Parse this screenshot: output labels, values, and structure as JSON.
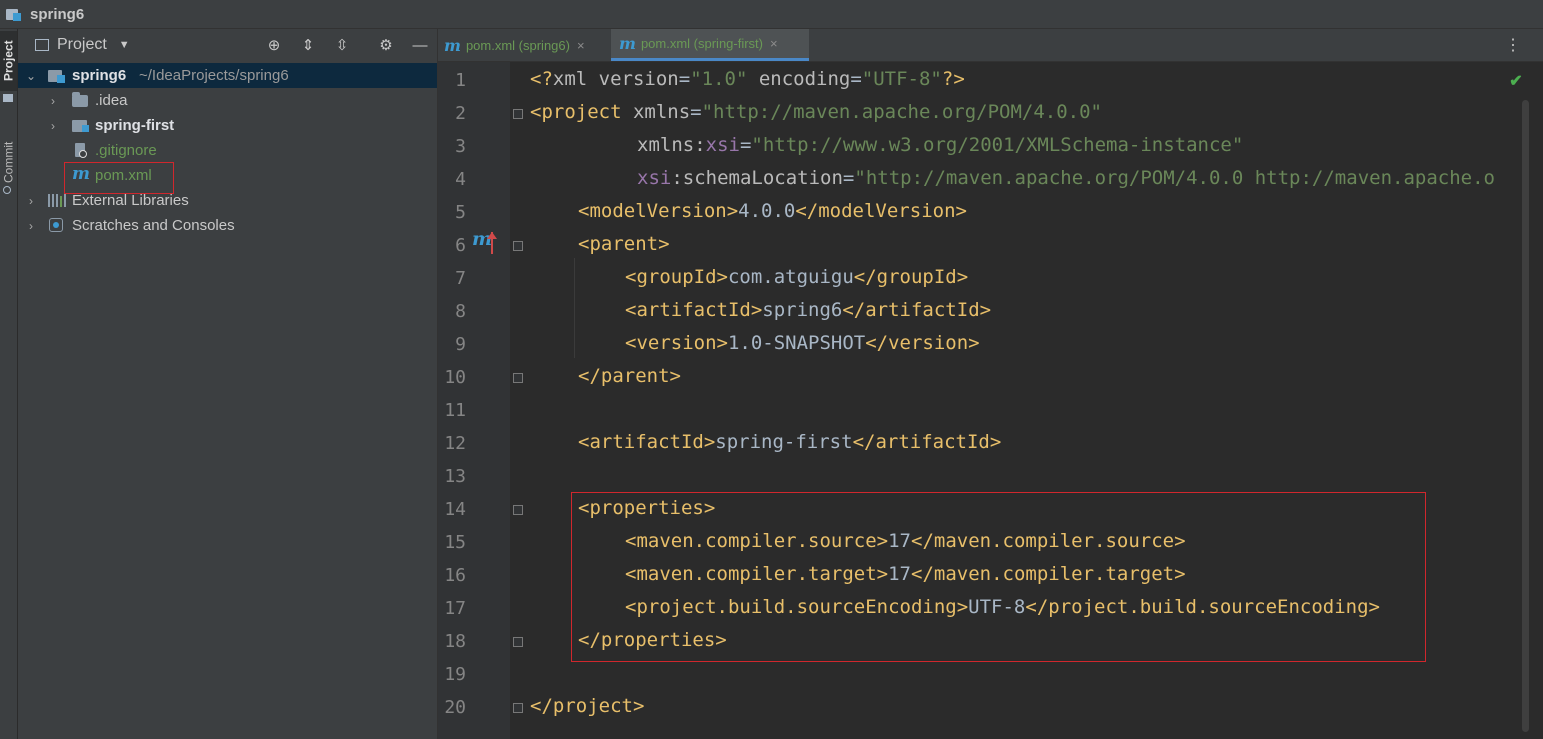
{
  "window": {
    "title": "spring6"
  },
  "sidebar_tabs": {
    "project": "Project",
    "commit": "Commit"
  },
  "project_panel": {
    "header_label": "Project",
    "tree": [
      {
        "label": "spring6",
        "path": "~/IdeaProjects/spring6"
      },
      {
        "label": ".idea"
      },
      {
        "label": "spring-first"
      },
      {
        "label": ".gitignore"
      },
      {
        "label": "pom.xml"
      },
      {
        "label": "External Libraries"
      },
      {
        "label": "Scratches and Consoles"
      }
    ]
  },
  "tabs": [
    {
      "label": "pom.xml (spring6)",
      "close": "×"
    },
    {
      "label": "pom.xml (spring-first)",
      "close": "×"
    }
  ],
  "editor": {
    "lines": [
      "1",
      "2",
      "3",
      "4",
      "5",
      "6",
      "7",
      "8",
      "9",
      "10",
      "11",
      "12",
      "13",
      "14",
      "15",
      "16",
      "17",
      "18",
      "19",
      "20"
    ],
    "gutter_mark": "m",
    "code": {
      "l1": {
        "a": "<?",
        "b": "xml version",
        "c": "=",
        "d": "\"1.0\"",
        "e": " encoding",
        "f": "=",
        "g": "\"UTF-8\"",
        "h": "?>"
      },
      "l2": {
        "a": "<project ",
        "b": "xmlns",
        "c": "=",
        "d": "\"http://maven.apache.org/POM/4.0.0\""
      },
      "l3": {
        "a": "xmlns:",
        "b": "xsi",
        "c": "=",
        "d": "\"http://www.w3.org/2001/XMLSchema-instance\""
      },
      "l4": {
        "a": "xsi",
        "b": ":schemaLocation",
        "c": "=",
        "d": "\"http://maven.apache.org/POM/4.0.0 http://maven.apache.o"
      },
      "l5": {
        "a": "<modelVersion>",
        "b": "4.0.0",
        "c": "</modelVersion>"
      },
      "l6": {
        "a": "<parent>"
      },
      "l7": {
        "a": "<groupId>",
        "b": "com.atguigu",
        "c": "</groupId>"
      },
      "l8": {
        "a": "<artifactId>",
        "b": "spring6",
        "c": "</artifactId>"
      },
      "l9": {
        "a": "<version>",
        "b": "1.0-SNAPSHOT",
        "c": "</version>"
      },
      "l10": {
        "a": "</parent>"
      },
      "l12": {
        "a": "<artifactId>",
        "b": "spring-first",
        "c": "</artifactId>"
      },
      "l14": {
        "a": "<properties>"
      },
      "l15": {
        "a": "<maven.compiler.source>",
        "b": "17",
        "c": "</maven.compiler.source>"
      },
      "l16": {
        "a": "<maven.compiler.target>",
        "b": "17",
        "c": "</maven.compiler.target>"
      },
      "l17": {
        "a": "<project.build.sourceEncoding>",
        "b": "UTF-8",
        "c": "</project.build.sourceEncoding>"
      },
      "l18": {
        "a": "</properties>"
      },
      "l20": {
        "a": "</project>"
      }
    }
  },
  "colors": {
    "tag": "#e8bf6a",
    "string": "#6a8759",
    "namespace": "#9876aa",
    "highlight_box": "#d0272d",
    "maven_icon": "#3d9ad1",
    "git_ignored": "#6a9955"
  }
}
